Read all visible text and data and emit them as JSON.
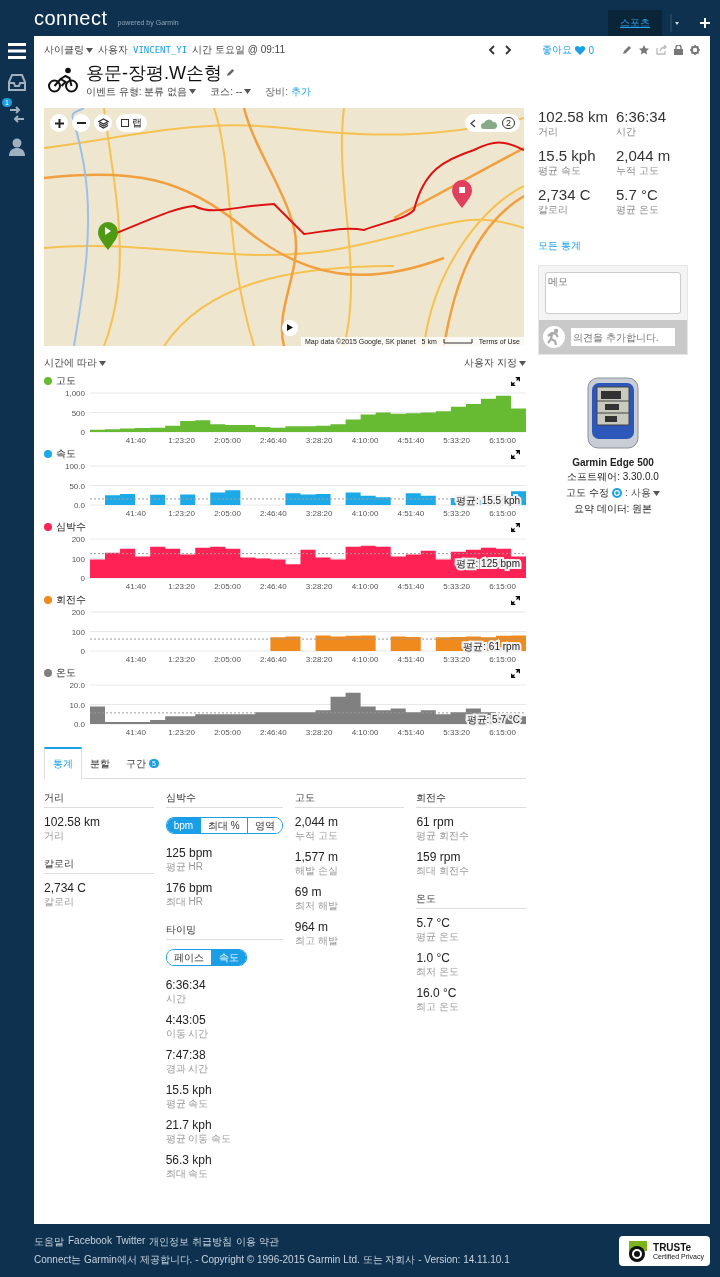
{
  "header": {
    "logo": "connect",
    "powered_by": "powered by Garmin",
    "tabs": [
      {
        "label": "스포츠",
        "selected": true
      }
    ]
  },
  "sidebar": {
    "items": [
      {
        "kind": "menu"
      },
      {
        "kind": "inbox"
      },
      {
        "kind": "connections",
        "badge": "1"
      },
      {
        "kind": "profile"
      }
    ]
  },
  "activity": {
    "type": "사이클링",
    "user_label": "사용자",
    "user": "VINCENT_YI",
    "time": "시간 토요일 @ 09:11",
    "likes_label": "좋아요",
    "likes": "0",
    "title": "용문-장평.W손형",
    "event_type": "이벤트 유형: 분류 없음",
    "course": "코스: --",
    "gear_label": "장비:",
    "gear_link": "추가"
  },
  "map": {
    "lap_label": "랩",
    "lap_checked": false,
    "weather_count": "2",
    "attribution": "Map data ©2015 Google, SK planet",
    "scale": "5 km",
    "terms": "Terms of Use"
  },
  "summary": {
    "stats": [
      {
        "value": "102.58 km",
        "label": "거리"
      },
      {
        "value": "6:36:34",
        "label": "시간"
      },
      {
        "value": "15.5 kph",
        "label": "평균 속도"
      },
      {
        "value": "2,044 m",
        "label": "누적 고도"
      },
      {
        "value": "2,734 C",
        "label": "칼로리"
      },
      {
        "value": "5.7 °C",
        "label": "평균 온도"
      }
    ],
    "all_stats_link": "모든 통계"
  },
  "comments": {
    "memo_placeholder": "메모",
    "comment_placeholder": "의견을 추가합니다."
  },
  "device": {
    "name": "Garmin Edge 500",
    "software": "소프트웨어: 3.30.0.0",
    "correction_label": "고도 수정",
    "correction_value": ": 사용",
    "summary_data": "요약 데이터: 원본"
  },
  "charts_header": {
    "x_mode": "시간에 따라",
    "layout": "사용자 지정"
  },
  "charts": [
    {
      "chart_data": {
        "type": "area",
        "x": [
          0,
          820,
          1640,
          2460,
          3280,
          4100,
          4920,
          5740,
          6560,
          7380,
          8200,
          9020,
          9840,
          10660,
          11480,
          12300,
          13120,
          13940,
          14760,
          15580,
          16400,
          17220,
          18040,
          18860,
          19680,
          20500,
          21320,
          22140,
          22960,
          23780
        ],
        "xlim": [
          0,
          23780
        ],
        "ylim": [
          0,
          1000
        ],
        "xticks": [
          {
            "value": 2500,
            "label": "41:40"
          },
          {
            "value": 5000,
            "label": "1:23:20"
          },
          {
            "value": 7500,
            "label": "2:05:00"
          },
          {
            "value": 10000,
            "label": "2:46:40"
          },
          {
            "value": 12500,
            "label": "3:28:20"
          },
          {
            "value": 15000,
            "label": "4:10:00"
          },
          {
            "value": 17500,
            "label": "4:51:40"
          },
          {
            "value": 20000,
            "label": "5:33:20"
          },
          {
            "value": 22500,
            "label": "6:15:00"
          }
        ],
        "yticks": [
          0,
          500,
          {
            "value": 1000,
            "label": "1,000"
          }
        ],
        "series": [
          {
            "name": "고도",
            "color": "#66bb33",
            "values": [
              60,
              70,
              90,
              100,
              110,
              160,
              280,
              300,
              200,
              180,
              180,
              130,
              110,
              150,
              150,
              160,
              200,
              320,
              450,
              500,
              470,
              480,
              500,
              530,
              650,
              720,
              850,
              930,
              600,
              520
            ]
          }
        ]
      }
    },
    {
      "chart_data": {
        "type": "area",
        "x": [
          0,
          820,
          1640,
          2460,
          3280,
          4100,
          4920,
          5740,
          6560,
          7380,
          8200,
          9020,
          9840,
          10660,
          11480,
          12300,
          13120,
          13940,
          14760,
          15580,
          16400,
          17220,
          18040,
          18860,
          19680,
          20500,
          21320,
          22140,
          22960,
          23780
        ],
        "xlim": [
          0,
          23780
        ],
        "ylim": [
          0,
          100
        ],
        "xticks": [
          {
            "value": 2500,
            "label": "41:40"
          },
          {
            "value": 5000,
            "label": "1:23:20"
          },
          {
            "value": 7500,
            "label": "2:05:00"
          },
          {
            "value": 10000,
            "label": "2:46:40"
          },
          {
            "value": 12500,
            "label": "3:28:20"
          },
          {
            "value": 15000,
            "label": "4:10:00"
          },
          {
            "value": 17500,
            "label": "4:51:40"
          },
          {
            "value": 20000,
            "label": "5:33:20"
          },
          {
            "value": 22500,
            "label": "6:15:00"
          }
        ],
        "yticks": [
          {
            "value": 0,
            "label": "0.0"
          },
          {
            "value": 50,
            "label": "50.0"
          },
          {
            "value": 100,
            "label": "100.0"
          }
        ],
        "series": [
          {
            "name": "속도",
            "color": "#1ba9e8",
            "values": [
              0,
              25,
              28,
              0,
              26,
              0,
              27,
              0,
              32,
              38,
              0,
              0,
              0,
              30,
              27,
              28,
              0,
              32,
              24,
              20,
              0,
              30,
              24,
              0,
              18,
              12,
              14,
              0,
              35,
              22
            ]
          }
        ],
        "ref_lines": [
          {
            "axis": "y",
            "value": 15.5,
            "label": "평균: 15.5 kph"
          }
        ]
      }
    },
    {
      "chart_data": {
        "type": "area",
        "x": [
          0,
          820,
          1640,
          2460,
          3280,
          4100,
          4920,
          5740,
          6560,
          7380,
          8200,
          9020,
          9840,
          10660,
          11480,
          12300,
          13120,
          13940,
          14760,
          15580,
          16400,
          17220,
          18040,
          18860,
          19680,
          20500,
          21320,
          22140,
          22960,
          23780
        ],
        "xlim": [
          0,
          23780
        ],
        "ylim": [
          0,
          200
        ],
        "xticks": [
          {
            "value": 2500,
            "label": "41:40"
          },
          {
            "value": 5000,
            "label": "1:23:20"
          },
          {
            "value": 7500,
            "label": "2:05:00"
          },
          {
            "value": 10000,
            "label": "2:46:40"
          },
          {
            "value": 12500,
            "label": "3:28:20"
          },
          {
            "value": 15000,
            "label": "4:10:00"
          },
          {
            "value": 17500,
            "label": "4:51:40"
          },
          {
            "value": 20000,
            "label": "5:33:20"
          },
          {
            "value": 22500,
            "label": "6:15:00"
          }
        ],
        "yticks": [
          0,
          100,
          200
        ],
        "series": [
          {
            "name": "심박수",
            "color": "#ff2255",
            "values": [
              95,
              130,
              150,
              110,
              160,
              150,
              120,
              155,
              160,
              150,
              105,
              100,
              95,
              70,
              145,
              105,
              95,
              160,
              165,
              160,
              110,
              120,
              140,
              95,
              135,
              145,
              155,
              150,
              110,
              130
            ]
          }
        ],
        "ref_lines": [
          {
            "axis": "y",
            "value": 125,
            "label": "평균: 125 bpm"
          }
        ]
      }
    },
    {
      "chart_data": {
        "type": "area",
        "x": [
          0,
          820,
          1640,
          2460,
          3280,
          4100,
          4920,
          5740,
          6560,
          7380,
          8200,
          9020,
          9840,
          10660,
          11480,
          12300,
          13120,
          13940,
          14760,
          15580,
          16400,
          17220,
          18040,
          18860,
          19680,
          20500,
          21320,
          22140,
          22960,
          23780
        ],
        "xlim": [
          0,
          23780
        ],
        "ylim": [
          0,
          200
        ],
        "xticks": [
          {
            "value": 2500,
            "label": "41:40"
          },
          {
            "value": 5000,
            "label": "1:23:20"
          },
          {
            "value": 7500,
            "label": "2:05:00"
          },
          {
            "value": 10000,
            "label": "2:46:40"
          },
          {
            "value": 12500,
            "label": "3:28:20"
          },
          {
            "value": 15000,
            "label": "4:10:00"
          },
          {
            "value": 17500,
            "label": "4:51:40"
          },
          {
            "value": 20000,
            "label": "5:33:20"
          },
          {
            "value": 22500,
            "label": "6:15:00"
          }
        ],
        "yticks": [
          0,
          100,
          200
        ],
        "series": [
          {
            "name": "회전수",
            "color": "#f08a1c",
            "values": [
              0,
              0,
              0,
              0,
              0,
              0,
              0,
              0,
              0,
              0,
              0,
              0,
              70,
              75,
              0,
              80,
              75,
              78,
              80,
              0,
              75,
              72,
              0,
              70,
              72,
              75,
              70,
              78,
              80,
              82
            ]
          }
        ],
        "ref_lines": [
          {
            "axis": "y",
            "value": 61,
            "label": "평균: 61 rpm"
          }
        ]
      }
    },
    {
      "chart_data": {
        "type": "area",
        "x": [
          0,
          820,
          1640,
          2460,
          3280,
          4100,
          4920,
          5740,
          6560,
          7380,
          8200,
          9020,
          9840,
          10660,
          11480,
          12300,
          13120,
          13940,
          14760,
          15580,
          16400,
          17220,
          18040,
          18860,
          19680,
          20500,
          21320,
          22140,
          22960,
          23780
        ],
        "xlim": [
          0,
          23780
        ],
        "ylim": [
          0,
          20
        ],
        "xticks": [
          {
            "value": 2500,
            "label": "41:40"
          },
          {
            "value": 5000,
            "label": "1:23:20"
          },
          {
            "value": 7500,
            "label": "2:05:00"
          },
          {
            "value": 10000,
            "label": "2:46:40"
          },
          {
            "value": 12500,
            "label": "3:28:20"
          },
          {
            "value": 15000,
            "label": "4:10:00"
          },
          {
            "value": 17500,
            "label": "4:51:40"
          },
          {
            "value": 20000,
            "label": "5:33:20"
          },
          {
            "value": 22500,
            "label": "6:15:00"
          }
        ],
        "yticks": [
          {
            "value": 0,
            "label": "0.0"
          },
          {
            "value": 10,
            "label": "10.0"
          },
          {
            "value": 20,
            "label": "20.0"
          }
        ],
        "series": [
          {
            "name": "온도",
            "color": "#808080",
            "values": [
              9,
              1,
              1,
              1,
              2,
              4,
              4,
              5,
              5,
              5,
              5,
              6,
              6,
              6,
              6,
              7,
              14,
              16,
              9,
              7,
              8,
              6,
              7,
              5,
              6,
              8,
              6,
              5,
              4,
              3
            ]
          }
        ],
        "ref_lines": [
          {
            "axis": "y",
            "value": 5.7,
            "label": "평균: 5.7 °C"
          }
        ]
      }
    }
  ],
  "tabs": [
    {
      "label": "통계",
      "selected": true
    },
    {
      "label": "분할",
      "selected": false
    },
    {
      "label": "구간",
      "badge": "5",
      "selected": false
    }
  ],
  "stats": {
    "columns": [
      {
        "groups": [
          {
            "title": "거리",
            "items": [
              {
                "value": "102.58 km",
                "label": "거리"
              }
            ]
          },
          {
            "title": "칼로리",
            "items": [
              {
                "value": "2,734 C",
                "label": "칼로리"
              }
            ]
          }
        ]
      },
      {
        "groups": [
          {
            "title": "심박수",
            "toggle": [
              {
                "label": "bpm",
                "selected": true
              },
              {
                "label": "최대 %",
                "selected": false
              },
              {
                "label": "영역",
                "selected": false
              }
            ],
            "items": [
              {
                "value": "125 bpm",
                "label": "평균 HR"
              },
              {
                "value": "176 bpm",
                "label": "최대 HR"
              }
            ]
          },
          {
            "title": "타이밍",
            "toggle": [
              {
                "label": "페이스",
                "selected": false
              },
              {
                "label": "속도",
                "selected": true
              }
            ],
            "items": [
              {
                "value": "6:36:34",
                "label": "시간"
              },
              {
                "value": "4:43:05",
                "label": "이동 시간"
              },
              {
                "value": "7:47:38",
                "label": "경과 시간"
              },
              {
                "value": "15.5 kph",
                "label": "평균 속도"
              },
              {
                "value": "21.7 kph",
                "label": "평균 이동 속도"
              },
              {
                "value": "56.3 kph",
                "label": "최대 속도"
              }
            ]
          }
        ]
      },
      {
        "groups": [
          {
            "title": "고도",
            "items": [
              {
                "value": "2,044 m",
                "label": "누적 고도"
              },
              {
                "value": "1,577 m",
                "label": "해발 손실"
              },
              {
                "value": "69 m",
                "label": "최저 해발"
              },
              {
                "value": "964 m",
                "label": "최고 해발"
              }
            ]
          }
        ]
      },
      {
        "groups": [
          {
            "title": "회전수",
            "items": [
              {
                "value": "61 rpm",
                "label": "평균 회전수"
              },
              {
                "value": "159 rpm",
                "label": "최대 회전수"
              }
            ]
          },
          {
            "title": "온도",
            "items": [
              {
                "value": "5.7 °C",
                "label": "평균 온도"
              },
              {
                "value": "1.0 °C",
                "label": "최저 온도"
              },
              {
                "value": "16.0 °C",
                "label": "최고 온도"
              }
            ]
          }
        ]
      }
    ]
  },
  "footer": {
    "links": [
      "도움말",
      "Facebook",
      "Twitter",
      "개인정보 취급방침",
      "이용 약관"
    ],
    "copyright": "Connect는 Garmin에서 제공합니다. - Copyright © 1996-2015 Garmin Ltd. 또는 자회사 - Version: 14.11.10.1",
    "badge_title": "TRUSTe",
    "badge_subtitle": "Certified Privacy"
  }
}
